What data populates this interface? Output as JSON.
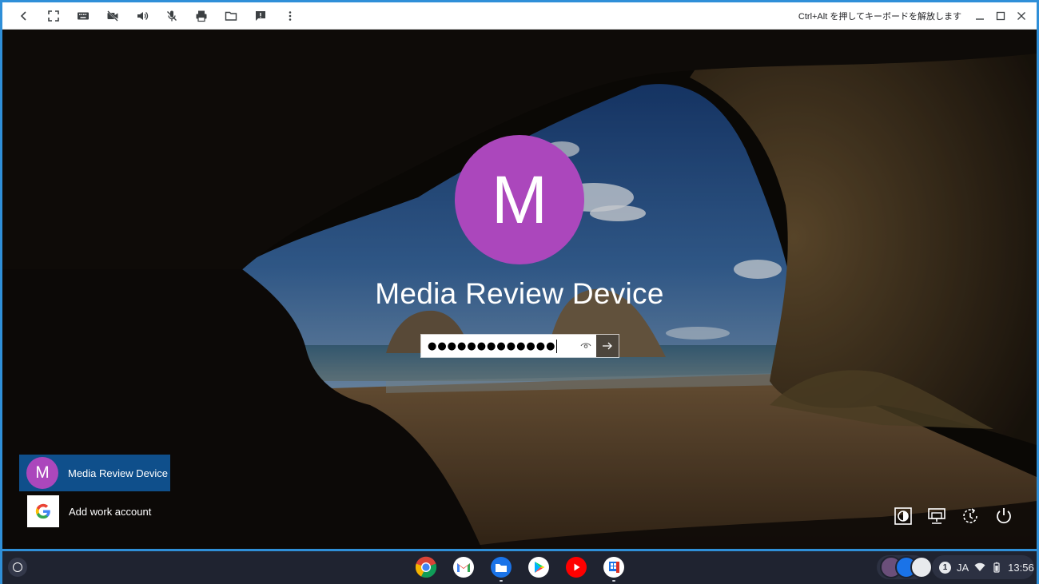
{
  "toolbar": {
    "buttons": [
      "back-icon",
      "fullscreen-icon",
      "keyboard-icon",
      "camera-off-icon",
      "volume-icon",
      "mic-off-icon",
      "print-icon",
      "folder-icon",
      "feedback-icon",
      "more-vert-icon"
    ],
    "hint": "Ctrl+Alt を押してキーボードを解放します"
  },
  "lock_screen": {
    "avatar_initial": "M",
    "username": "Media Review Device",
    "password_masked": "●●●●●●●●●●●●●",
    "accent_color": "#ab47bc"
  },
  "user_list": [
    {
      "initial": "M",
      "label": "Media Review Device",
      "selected": true
    },
    {
      "icon": "google-g-icon",
      "label": "Add work account",
      "selected": false
    }
  ],
  "system_icons": [
    "ease-of-access-icon",
    "network-icon",
    "accessibility-icon",
    "power-icon"
  ],
  "shelf": {
    "apps": [
      "chrome",
      "gmail",
      "files",
      "play-store",
      "youtube",
      "remote-desktop"
    ],
    "locale": "JA",
    "notification_count": "1",
    "time": "13:56"
  }
}
